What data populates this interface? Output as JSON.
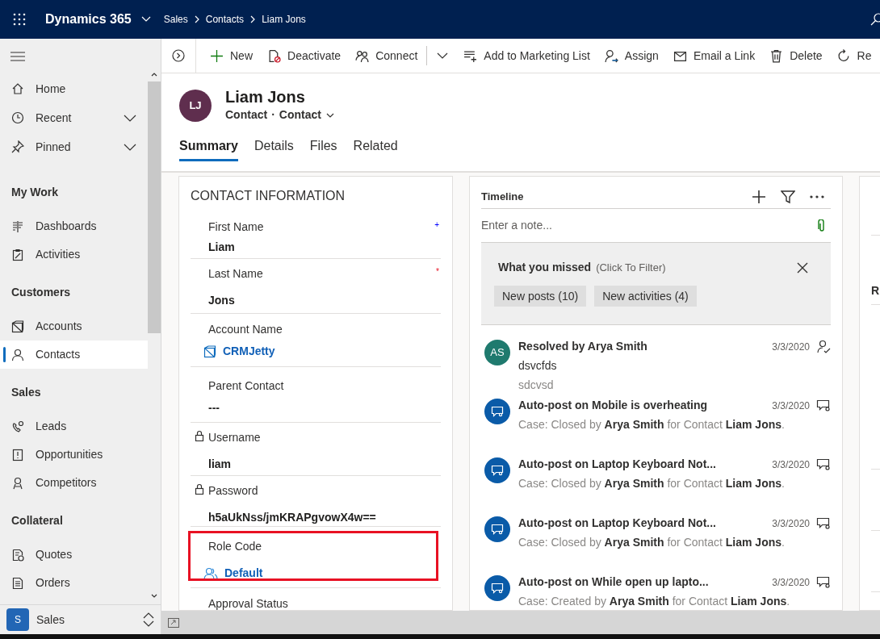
{
  "top_bar": {
    "app_name": "Dynamics 365",
    "breadcrumbs": [
      {
        "label": "Sales"
      },
      {
        "label": "Contacts"
      },
      {
        "label": "Liam Jons"
      }
    ]
  },
  "sidebar": {
    "top_items": [
      {
        "label": "Home",
        "expandable": false
      },
      {
        "label": "Recent",
        "expandable": true
      },
      {
        "label": "Pinned",
        "expandable": true
      }
    ],
    "groups": [
      {
        "title": "My Work",
        "items": [
          {
            "label": "Dashboards",
            "selected": false
          },
          {
            "label": "Activities",
            "selected": false
          }
        ]
      },
      {
        "title": "Customers",
        "items": [
          {
            "label": "Accounts",
            "selected": false
          },
          {
            "label": "Contacts",
            "selected": true
          }
        ]
      },
      {
        "title": "Sales",
        "items": [
          {
            "label": "Leads",
            "selected": false
          },
          {
            "label": "Opportunities",
            "selected": false
          },
          {
            "label": "Competitors",
            "selected": false
          }
        ]
      },
      {
        "title": "Collateral",
        "items": [
          {
            "label": "Quotes",
            "selected": false
          },
          {
            "label": "Orders",
            "selected": false
          }
        ]
      }
    ],
    "area_switcher": {
      "badge": "S",
      "label": "Sales"
    }
  },
  "command_bar": [
    {
      "kind": "new",
      "label": "New"
    },
    {
      "kind": "deactivate",
      "label": "Deactivate"
    },
    {
      "kind": "connect",
      "label": "Connect"
    },
    {
      "kind": "more"
    },
    {
      "kind": "list",
      "label": "Add to Marketing List"
    },
    {
      "kind": "assign",
      "label": "Assign"
    },
    {
      "kind": "email",
      "label": "Email a Link"
    },
    {
      "kind": "delete",
      "label": "Delete"
    },
    {
      "kind": "refresh",
      "label": "Re"
    }
  ],
  "record": {
    "initials": "LJ",
    "name": "Liam Jons",
    "entity": "Contact",
    "separator": "·",
    "form": "Contact"
  },
  "tabs": [
    {
      "label": "Summary",
      "selected": true
    },
    {
      "label": "Details",
      "selected": false
    },
    {
      "label": "Files",
      "selected": false
    },
    {
      "label": "Related",
      "selected": false
    }
  ],
  "contact_card": {
    "title": "CONTACT INFORMATION",
    "fields": [
      {
        "label": "First Name",
        "value": "Liam",
        "kind": "text",
        "locked": false,
        "highlighted": false,
        "required": false,
        "mark": "+"
      },
      {
        "label": "Last Name",
        "value": "Jons",
        "kind": "text",
        "locked": false,
        "highlighted": false,
        "required": true,
        "mark": "*"
      },
      {
        "label": "Account Name",
        "value": "CRMJetty",
        "kind": "account",
        "locked": false,
        "highlighted": false
      },
      {
        "label": "Parent Contact",
        "value": "---",
        "kind": "text",
        "locked": false,
        "highlighted": false
      },
      {
        "label": "Username",
        "value": "liam",
        "kind": "text",
        "locked": true,
        "highlighted": false
      },
      {
        "label": "Password",
        "value": "h5aUkNss/jmKRAPgvowX4w==",
        "kind": "text",
        "locked": true,
        "highlighted": false
      },
      {
        "label": "Role Code",
        "value": "Default",
        "kind": "role",
        "locked": false,
        "highlighted": true
      },
      {
        "label": "Approval Status",
        "kind": "text",
        "locked": false,
        "highlighted": false
      }
    ]
  },
  "timeline": {
    "title": "Timeline",
    "note_placeholder": "Enter a note...",
    "missed": {
      "title": "What you missed",
      "hint": "(Click To Filter)",
      "chips": [
        "New posts (10)",
        "New activities (4)"
      ]
    },
    "items": [
      {
        "kind": "resolved",
        "initials": "AS",
        "color": "#1f7a6e",
        "title": "Resolved by Arya Smith",
        "date": "3/3/2020",
        "lines": [
          "dsvcfds",
          "sdcvsd"
        ]
      },
      {
        "kind": "post",
        "title": "Auto-post on Mobile is overheating",
        "date": "3/3/2020",
        "lines": [
          "Case: Closed by **Arya Smith** for Contact **Liam Jons**."
        ]
      },
      {
        "kind": "post",
        "title": "Auto-post on Laptop Keyboard Not...",
        "date": "3/3/2020",
        "lines": [
          "Case: Closed by **Arya Smith** for Contact **Liam Jons**."
        ]
      },
      {
        "kind": "post",
        "title": "Auto-post on Laptop Keyboard Not...",
        "date": "3/3/2020",
        "lines": [
          "Case: Closed by **Arya Smith** for Contact **Liam Jons**."
        ]
      },
      {
        "kind": "post",
        "title": "Auto-post on While open up lapto...",
        "date": "3/3/2020",
        "lines": [
          "Case: Created by **Arya Smith** for Contact **Liam Jons**."
        ]
      }
    ]
  },
  "related_card": {
    "heading": "R"
  }
}
